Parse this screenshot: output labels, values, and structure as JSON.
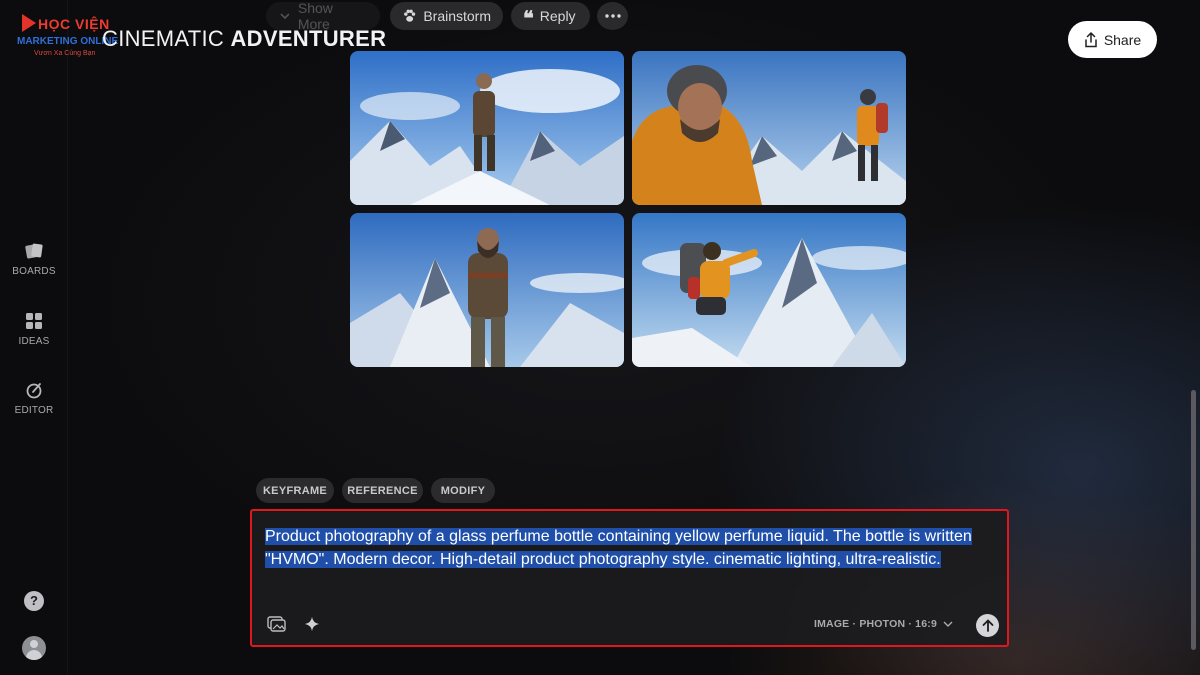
{
  "watermark": {
    "line1": "HỌC VIỆN",
    "line2": "MARKETING ONLINE",
    "line3": "Vươn Xa Cùng Bạn"
  },
  "board": {
    "title_light": "CINEMATIC ",
    "title_bold": "ADVENTURER"
  },
  "actions": {
    "show_more": "Show More",
    "brainstorm": "Brainstorm",
    "reply": "Reply",
    "share": "Share"
  },
  "sidebar": {
    "items": [
      {
        "label": "BOARDS",
        "icon": "boards-icon"
      },
      {
        "label": "IDEAS",
        "icon": "ideas-icon"
      },
      {
        "label": "EDITOR",
        "icon": "editor-icon"
      }
    ],
    "help": "?"
  },
  "images": [
    {
      "name": "explorer-on-snowy-ridge"
    },
    {
      "name": "climber-portrait-and-hiker"
    },
    {
      "name": "explorer-mountain-peak"
    },
    {
      "name": "climber-raising-arm-at-summit"
    }
  ],
  "modes": [
    "KEYFRAME",
    "REFERENCE",
    "MODIFY"
  ],
  "prompt": {
    "text": "Product photography of a glass perfume bottle containing yellow perfume liquid. The bottle is written \"HVMO\". Modern decor. High-detail product photography style. cinematic lighting, ultra-realistic.",
    "model_label": "IMAGE · PHOTON · 16:9"
  },
  "colors": {
    "background": "#0c0c0e",
    "highlight": "#1f4fa8",
    "annotation_border": "#e0171d"
  }
}
